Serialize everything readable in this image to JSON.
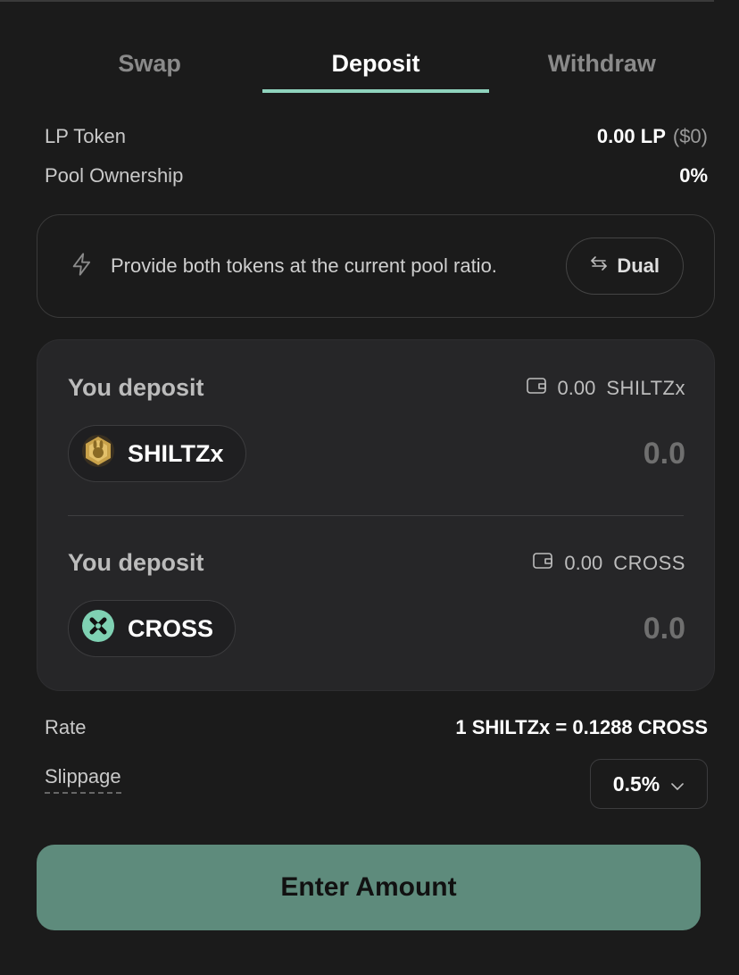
{
  "tabs": [
    {
      "label": "Swap"
    },
    {
      "label": "Deposit"
    },
    {
      "label": "Withdraw"
    }
  ],
  "pool": {
    "lp_token_label": "LP Token",
    "lp_token_value": "0.00 LP",
    "lp_token_usd": "($0)",
    "ownership_label": "Pool Ownership",
    "ownership_value": "0%"
  },
  "mode": {
    "description": "Provide both tokens at the current pool ratio.",
    "button_label": "Dual"
  },
  "deposits": [
    {
      "title": "You deposit",
      "balance": "0.00",
      "balance_symbol": "SHILTZx",
      "token": "SHILTZx",
      "amount": "0.0"
    },
    {
      "title": "You deposit",
      "balance": "0.00",
      "balance_symbol": "CROSS",
      "token": "CROSS",
      "amount": "0.0"
    }
  ],
  "rate": {
    "label": "Rate",
    "value": "1 SHILTZx = 0.1288 CROSS"
  },
  "slippage": {
    "label": "Slippage",
    "value": "0.5%"
  },
  "cta_label": "Enter Amount",
  "colors": {
    "accent": "#8fd3bd",
    "cta_bg": "#5e8b7c",
    "card_bg": "#262628",
    "page_bg": "#1b1b1b"
  }
}
